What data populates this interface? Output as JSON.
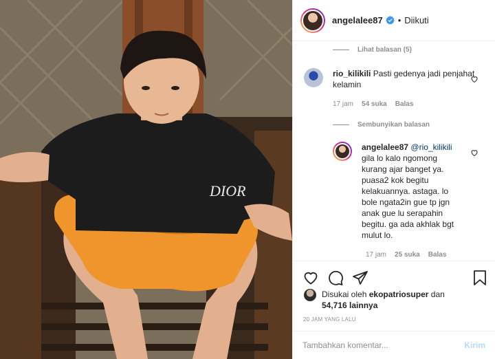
{
  "post": {
    "author": "angelalee87",
    "follow_status": "Diikuti",
    "separator": "•"
  },
  "comments": {
    "view_replies": "Lihat balasan (5)",
    "hide_replies": "Sembunyikan balasan",
    "items": [
      {
        "user": "rio_kilikili",
        "text": "Pasti gedenya jadi penjahat kelamin",
        "time": "17 jam",
        "likes": "54 suka",
        "reply": "Balas"
      },
      {
        "user": "angelalee87",
        "mention": "@rio_kilikili",
        "text": "gila lo kalo ngomong kurang ajar banget ya. puasa2 kok begitu kelakuannya. astaga. lo bole ngata2in gue tp jgn anak gue lu serapahin begitu. ga ada akhlak bgt mulut lo.",
        "time": "17 jam",
        "likes": "25 suka",
        "reply": "Balas"
      }
    ]
  },
  "likes": {
    "prefix": "Disukai oleh",
    "user": "ekopatriosuper",
    "conj": "dan",
    "count": "54,716 lainnya"
  },
  "timestamp": "20 JAM YANG LALU",
  "add_comment": {
    "placeholder": "Tambahkan komentar...",
    "post_label": "Kirim"
  },
  "photo": {
    "shirt_text": "DIOR"
  },
  "colors": {
    "verified": "#3897f0",
    "link": "#00376b",
    "post_disabled": "#b3dbff",
    "muted": "#8e8e8e"
  }
}
